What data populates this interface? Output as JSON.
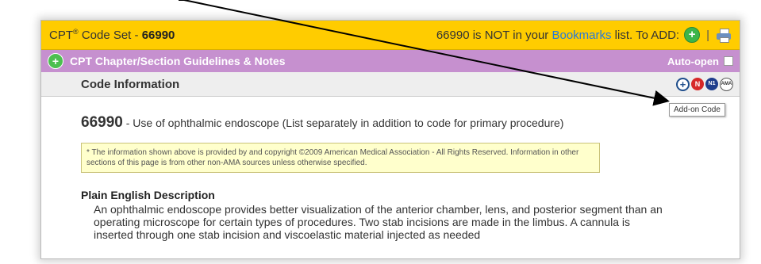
{
  "header": {
    "title_prefix": "CPT",
    "title_suffix": "Code Set - ",
    "code": "66990",
    "bookmark_prefix": "66990 is NOT in your ",
    "bookmark_link": "Bookmarks",
    "bookmark_suffix": " list. To ADD:",
    "separator": "|"
  },
  "guidelines_bar": {
    "title": "CPT Chapter/Section Guidelines & Notes",
    "auto_open_label": "Auto-open"
  },
  "code_info": {
    "title": "Code Information",
    "icons": [
      "add-on-icon",
      "new-code-icon",
      "n1-icon",
      "ama-icon"
    ]
  },
  "tooltip": {
    "text": "Add-on Code"
  },
  "code_line": {
    "code": "66990",
    "description": " - Use of ophthalmic endoscope (List separately in addition to code for primary procedure)"
  },
  "copyright": {
    "text": "* The information shown above is provided by and copyright ©2009 American Medical Association - All Rights Reserved.  Information in other sections of this page is from other non-AMA sources unless otherwise specified."
  },
  "plain_english": {
    "title": "Plain English Description",
    "text": "An ophthalmic endoscope provides better visualization of the anterior chamber, lens, and posterior segment than an operating microscope for certain types of procedures. Two stab incisions are made in the limbus. A cannula is inserted through one stab incision and viscoelastic material injected as needed"
  },
  "colors": {
    "top_bar": "#ffcc00",
    "guidelines_bar": "#c690cf",
    "link": "#2a7ad6",
    "add_green": "#3cb54a"
  }
}
